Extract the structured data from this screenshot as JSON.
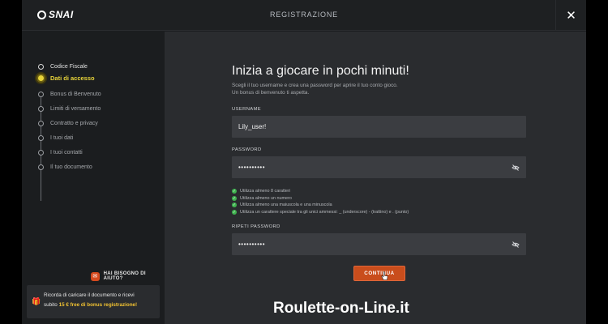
{
  "header": {
    "logo_text": "SNAI",
    "title": "REGISTRAZIONE",
    "close_icon": "close-icon"
  },
  "steps": [
    {
      "label": "Codice Fiscale",
      "state": "done"
    },
    {
      "label": "Dati di accesso",
      "state": "active"
    },
    {
      "label": "Bonus di Benvenuto",
      "state": "todo"
    },
    {
      "label": "Limiti di versamento",
      "state": "todo"
    },
    {
      "label": "Contratto e privacy",
      "state": "todo"
    },
    {
      "label": "I tuoi dati",
      "state": "todo"
    },
    {
      "label": "I tuoi contatti",
      "state": "todo"
    },
    {
      "label": "Il tuo documento",
      "state": "todo"
    }
  ],
  "help": {
    "label": "HAI BISOGNO DI AIUTO?",
    "icon": "chat-icon"
  },
  "promo": {
    "line1": "Ricorda di caricare il documento e ricevi",
    "line2_prefix": "subito",
    "amount": "15 €",
    "line2_suffix": "free di bonus registrazione!",
    "icon": "gift-icon"
  },
  "main": {
    "title": "Inizia a giocare in pochi minuti!",
    "subtitle_line1": "Scegli il tuo username e crea una password per aprire il tuo conto gioco.",
    "subtitle_line2": "Un bonus di benvenuto ti aspetta.",
    "username_label": "USERNAME",
    "username_value": "Lily_user!",
    "password_label": "PASSWORD",
    "password_mask": "••••••••••",
    "repeat_label": "RIPETI PASSWORD",
    "repeat_mask": "••••••••••",
    "rules": [
      "Utilizza almeno 8 caratteri",
      "Utilizza almeno un numero",
      "Utilizza almeno una maiuscola e una minuscola",
      "Utilizza un carattere speciale tra gli unici ammessi: _ (underscore) - (trattino) e . (punto)"
    ],
    "continue_label": "CONTINUA"
  },
  "watermark": "Roulette-on-Line.it",
  "colors": {
    "accent_orange": "#c94d1c",
    "active_step_yellow": "#e8d43a",
    "check_green": "#3fb34f",
    "promo_gold": "#f1c232"
  }
}
